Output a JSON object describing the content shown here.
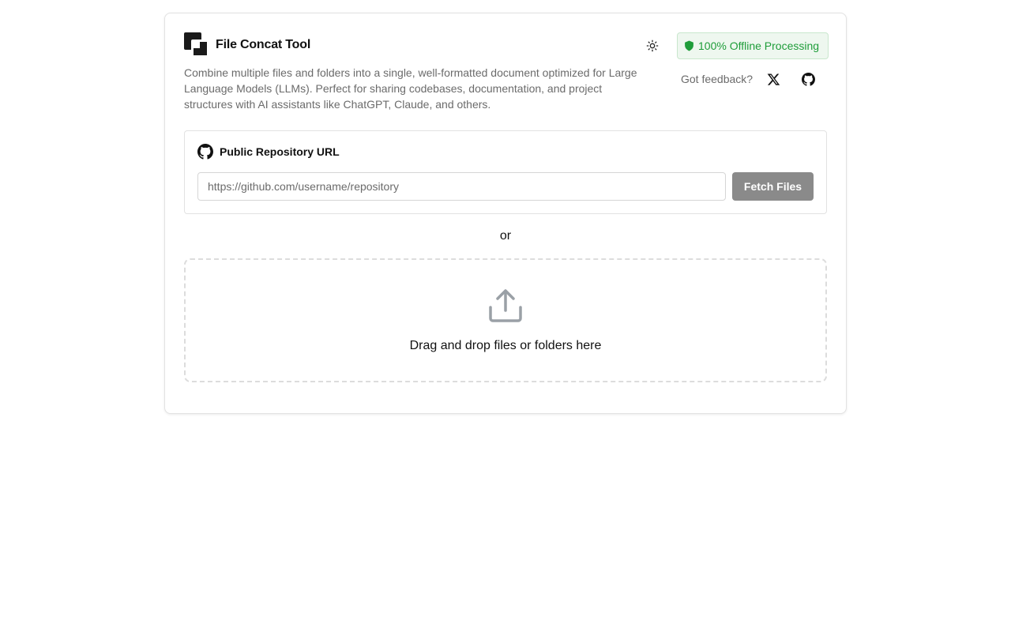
{
  "header": {
    "title": "File Concat Tool",
    "description": "Combine multiple files and folders into a single, well-formatted document optimized for Large Language Models (LLMs). Perfect for sharing codebases, documentation, and project structures with AI assistants like ChatGPT, Claude, and others.",
    "theme_toggle_icon": "sun-icon",
    "offline_badge": "100% Offline Processing",
    "offline_badge_icon": "shield-icon",
    "feedback_label": "Got feedback?",
    "social_icons": [
      "x-icon",
      "github-icon"
    ]
  },
  "repo": {
    "icon": "github-icon",
    "label": "Public Repository URL",
    "input_value": "",
    "input_placeholder": "https://github.com/username/repository",
    "fetch_button_label": "Fetch Files"
  },
  "divider": {
    "text": "or"
  },
  "dropzone": {
    "icon": "upload-icon",
    "text": "Drag and drop files or folders here"
  },
  "colors": {
    "accent_green": "#1f9d3a",
    "badge_bg": "#eef7ef",
    "button_disabled": "#8a8a8a"
  }
}
